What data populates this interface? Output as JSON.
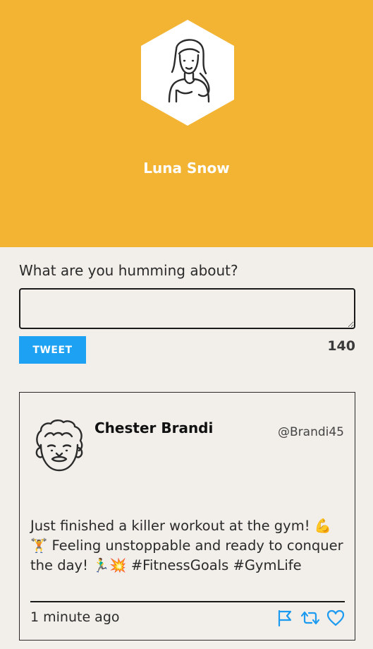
{
  "profile": {
    "name": "Luna Snow",
    "avatar_icon": "woman-portrait-icon",
    "header_color": "#f3b434"
  },
  "compose": {
    "label": "What are you humming about?",
    "value": "",
    "button_label": "TWEET",
    "char_count": "140",
    "button_color": "#1da1f2"
  },
  "tweet": {
    "author_name": "Chester Brandi",
    "author_handle": "@Brandi45",
    "avatar_icon": "man-curly-hair-icon",
    "text": "Just finished a killer workout at the gym! 💪🏋️ Feeling unstoppable and ready to conquer the day! 🏃‍♂️💥 #FitnessGoals #GymLife",
    "timestamp": "1 minute ago",
    "action_icons": [
      "flag-icon",
      "retweet-icon",
      "heart-icon"
    ],
    "action_color": "#1d9bf0"
  }
}
